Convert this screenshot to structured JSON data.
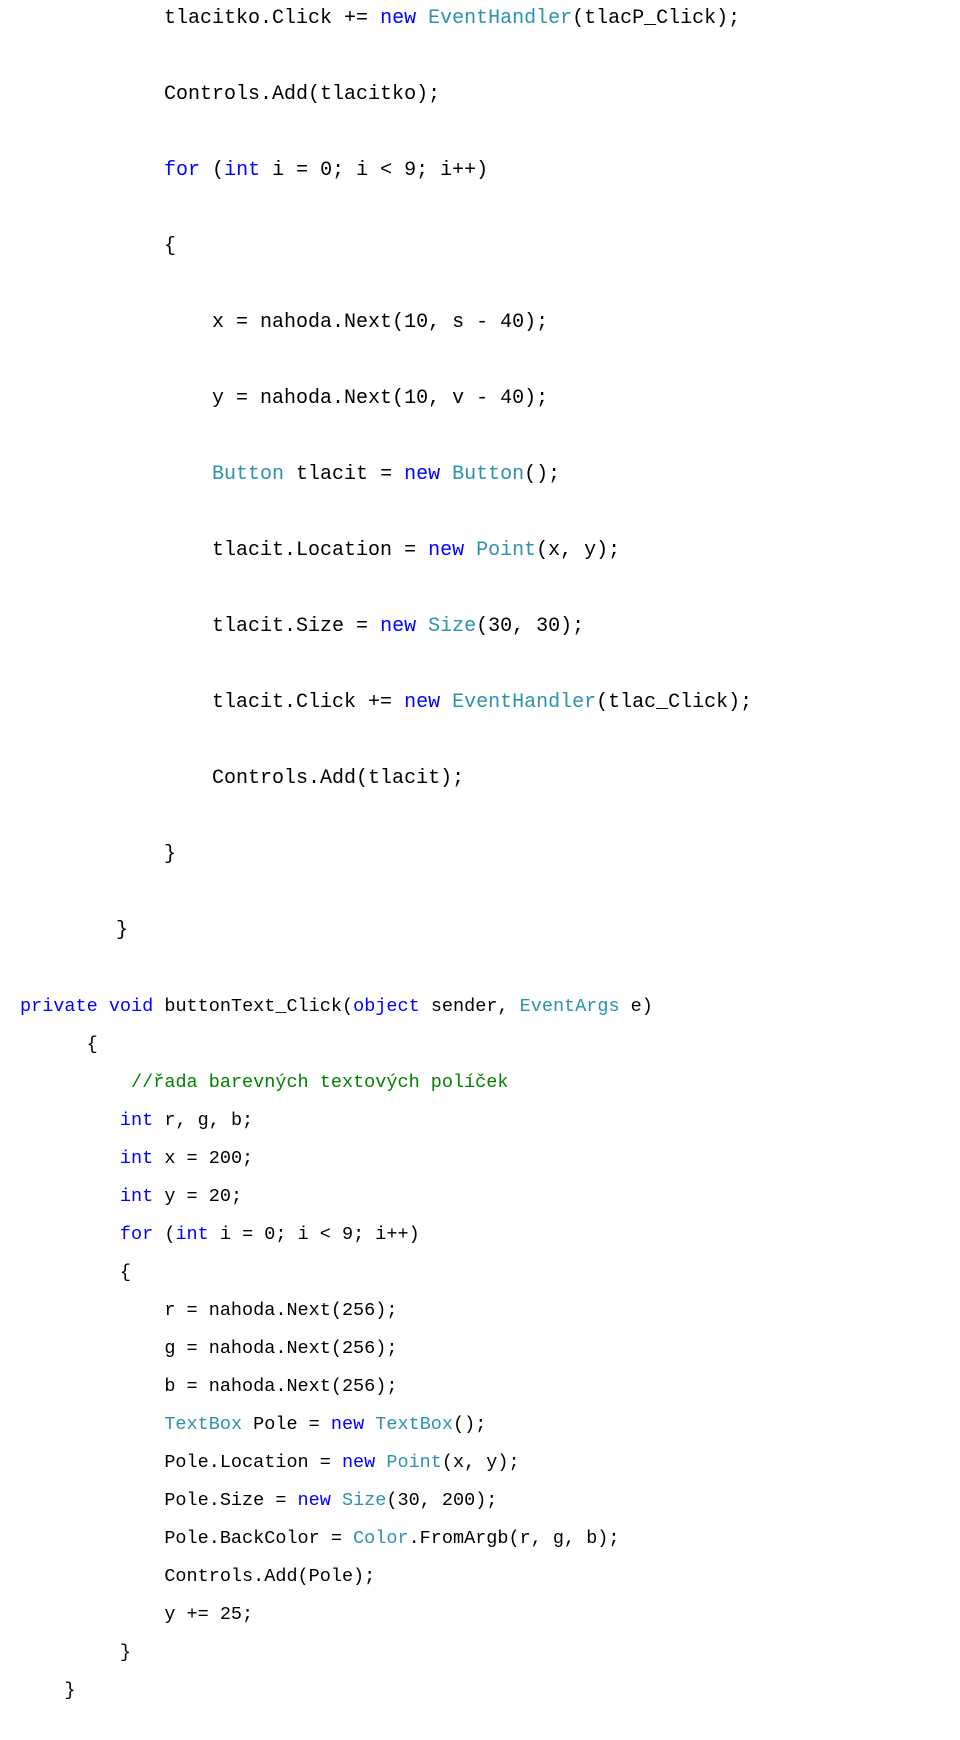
{
  "code": {
    "line01_a": "            tlacitko.Click += ",
    "line01_b": "new",
    "line01_c": " ",
    "line01_d": "EventHandler",
    "line01_e": "(tlacP_Click);",
    "blank01": "",
    "line02": "            Controls.Add(tlacitko);",
    "blank02": "",
    "line03_a": "            ",
    "line03_b": "for",
    "line03_c": " (",
    "line03_d": "int",
    "line03_e": " i = 0; i < 9; i++)",
    "blank03": "",
    "line04": "            {",
    "blank04": "",
    "line05": "                x = nahoda.Next(10, s - 40);",
    "blank05": "",
    "line06": "                y = nahoda.Next(10, v - 40);",
    "blank06": "",
    "line07_a": "                ",
    "line07_b": "Button",
    "line07_c": " tlacit = ",
    "line07_d": "new",
    "line07_e": " ",
    "line07_f": "Button",
    "line07_g": "();",
    "blank07": "",
    "line08_a": "                tlacit.Location = ",
    "line08_b": "new",
    "line08_c": " ",
    "line08_d": "Point",
    "line08_e": "(x, y);",
    "blank08": "",
    "line09_a": "                tlacit.Size = ",
    "line09_b": "new",
    "line09_c": " ",
    "line09_d": "Size",
    "line09_e": "(30, 30);",
    "blank09": "",
    "line10_a": "                tlacit.Click += ",
    "line10_b": "new",
    "line10_c": " ",
    "line10_d": "EventHandler",
    "line10_e": "(tlac_Click);",
    "blank10": "",
    "line11": "                Controls.Add(tlacit);",
    "blank11": "",
    "line12": "            }",
    "blank12": "",
    "line13": "        }",
    "blank13": "",
    "line14_a": "private",
    "line14_b": " ",
    "line14_c": "void",
    "line14_d": " buttonText_Click(",
    "line14_e": "object",
    "line14_f": " sender, ",
    "line14_g": "EventArgs",
    "line14_h": " e)",
    "line15": "      {",
    "line16_a": "          ",
    "line16_b": "//řada barevných textových políček",
    "line17_a": "         ",
    "line17_b": "int",
    "line17_c": " r, g, b;",
    "line18_a": "         ",
    "line18_b": "int",
    "line18_c": " x = 200;",
    "line19_a": "         ",
    "line19_b": "int",
    "line19_c": " y = 20;",
    "line20_a": "         ",
    "line20_b": "for",
    "line20_c": " (",
    "line20_d": "int",
    "line20_e": " i = 0; i < 9; i++)",
    "line21": "         {",
    "line22": "             r = nahoda.Next(256);",
    "line23": "             g = nahoda.Next(256);",
    "line24": "             b = nahoda.Next(256);",
    "line25_a": "             ",
    "line25_b": "TextBox",
    "line25_c": " Pole = ",
    "line25_d": "new",
    "line25_e": " ",
    "line25_f": "TextBox",
    "line25_g": "();",
    "line26_a": "             Pole.Location = ",
    "line26_b": "new",
    "line26_c": " ",
    "line26_d": "Point",
    "line26_e": "(x, y);",
    "line27_a": "             Pole.Size = ",
    "line27_b": "new",
    "line27_c": " ",
    "line27_d": "Size",
    "line27_e": "(30, 200);",
    "line28_a": "             Pole.BackColor = ",
    "line28_b": "Color",
    "line28_c": ".FromArgb(r, g, b);",
    "line29": "             Controls.Add(Pole);",
    "line30": "             y += 25;",
    "line31": "         }",
    "line32": "    }"
  }
}
